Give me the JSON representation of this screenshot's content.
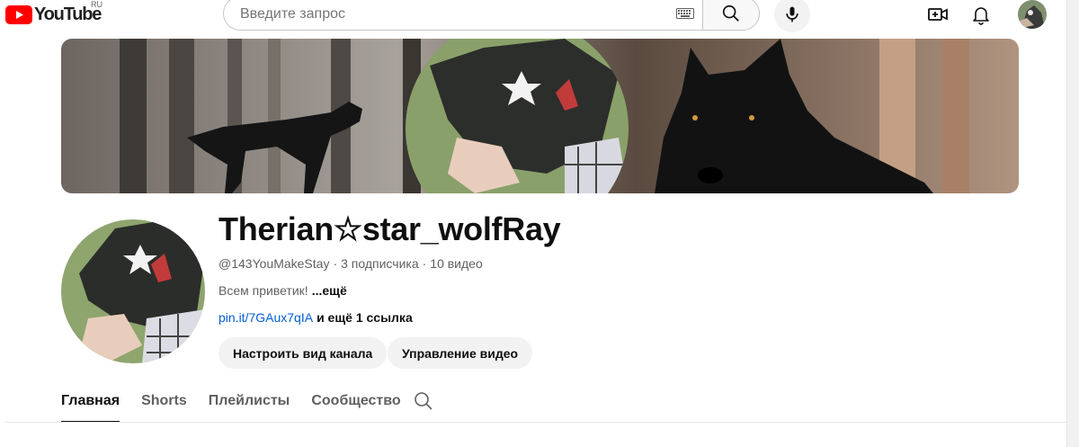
{
  "masthead": {
    "logo_text": "YouTube",
    "region": "RU",
    "search_placeholder": "Введите запрос",
    "icons": [
      "menu-logo",
      "keyboard-icon",
      "search-icon",
      "mic-icon",
      "create-icon",
      "bell-icon"
    ]
  },
  "channel": {
    "title": "Therian☆star_wolfRay",
    "handle": "@143YouMakeStay",
    "subscribers": "3 подписчика",
    "videos": "10 видео",
    "description": "Всем приветик!",
    "more_label": "...ещё",
    "link_text": "pin.it/7GAux7qIA",
    "extra_links": "и ещё 1 ссылка"
  },
  "buttons": {
    "customize": "Настроить вид канала",
    "manage": "Управление видео"
  },
  "tabs": [
    "Главная",
    "Shorts",
    "Плейлисты",
    "Сообщество"
  ],
  "colors": {
    "brand_red": "#ff0000",
    "link_blue": "#065fd4",
    "text_primary": "#0f0f0f",
    "text_secondary": "#606060"
  }
}
